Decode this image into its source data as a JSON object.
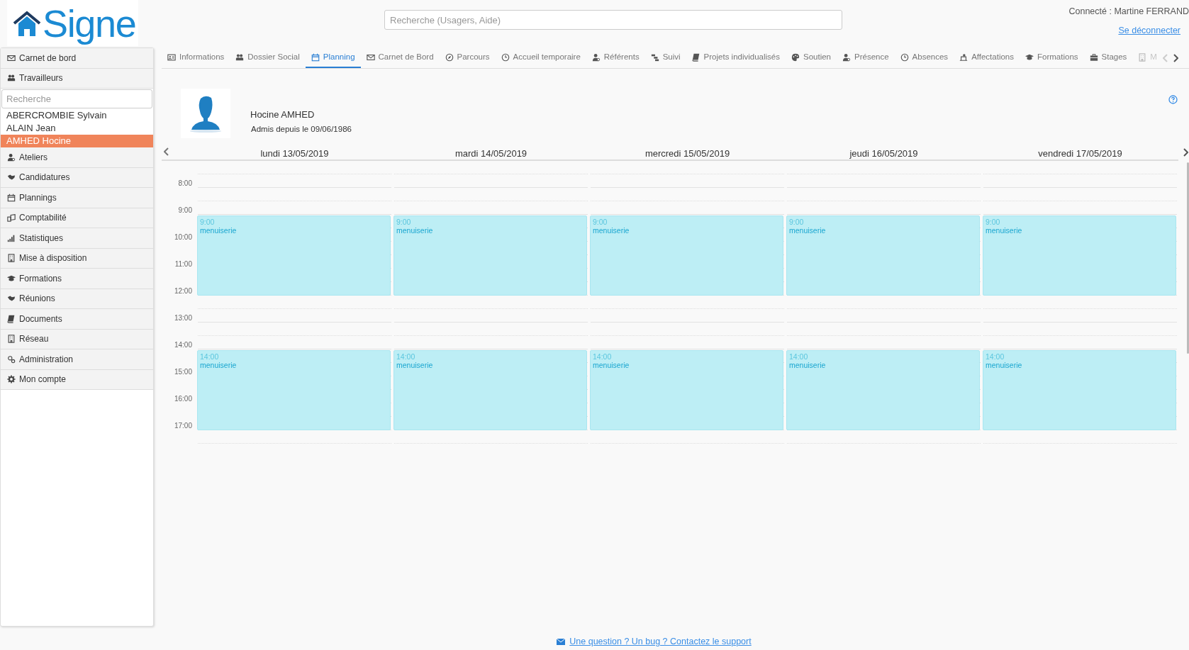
{
  "header": {
    "logo": "Signe",
    "search": {
      "placeholder": "Recherche (Usagers, Aide)"
    },
    "user": "Connecté : Martine FERRAND",
    "logout": "Se déconnecter"
  },
  "sidebar": {
    "items": [
      {
        "kind": "nav",
        "label": "Carnet de bord"
      },
      {
        "kind": "nav",
        "label": "Travailleurs"
      },
      {
        "kind": "search",
        "placeholder": "Recherche"
      },
      {
        "kind": "person",
        "label": "ABERCROMBIE Sylvain",
        "selected": false
      },
      {
        "kind": "person",
        "label": "ALAIN Jean",
        "selected": false
      },
      {
        "kind": "person",
        "label": "AMHED Hocine",
        "selected": true
      },
      {
        "kind": "nav",
        "label": "Ateliers"
      },
      {
        "kind": "nav",
        "label": "Candidatures"
      },
      {
        "kind": "nav",
        "label": "Plannings"
      },
      {
        "kind": "nav",
        "label": "Comptabilité"
      },
      {
        "kind": "nav",
        "label": "Statistiques"
      },
      {
        "kind": "nav",
        "label": "Mise à disposition"
      },
      {
        "kind": "nav",
        "label": "Formations"
      },
      {
        "kind": "nav",
        "label": "Réunions"
      },
      {
        "kind": "nav",
        "label": "Documents"
      },
      {
        "kind": "nav",
        "label": "Réseau"
      },
      {
        "kind": "nav",
        "label": "Administration"
      },
      {
        "kind": "nav",
        "label": "Mon compte"
      }
    ]
  },
  "tabs": [
    {
      "label": "Informations",
      "selected": false
    },
    {
      "label": "Dossier Social",
      "selected": false
    },
    {
      "label": "Planning",
      "selected": true
    },
    {
      "label": "Carnet de Bord",
      "selected": false
    },
    {
      "label": "Parcours",
      "selected": false
    },
    {
      "label": "Accueil temporaire",
      "selected": false
    },
    {
      "label": "Référents",
      "selected": false
    },
    {
      "label": "Suivi",
      "selected": false
    },
    {
      "label": "Projets individualisés",
      "selected": false
    },
    {
      "label": "Soutien",
      "selected": false
    },
    {
      "label": "Présence",
      "selected": false
    },
    {
      "label": "Absences",
      "selected": false
    },
    {
      "label": "Affectations",
      "selected": false
    },
    {
      "label": "Formations",
      "selected": false
    },
    {
      "label": "Stages",
      "selected": false
    },
    {
      "label": "M",
      "selected": false
    }
  ],
  "person": {
    "name": "Hocine AMHED",
    "admitted": "Admis depuis le 09/06/1986"
  },
  "calendar": {
    "hours": [
      "8:00",
      "9:00",
      "10:00",
      "11:00",
      "12:00",
      "13:00",
      "14:00",
      "15:00",
      "16:00",
      "17:00"
    ],
    "days": [
      {
        "label": "lundi 13/05/2019",
        "events": [
          {
            "time": "9:00",
            "title": "menuiserie"
          },
          {
            "time": "14:00",
            "title": "menuiserie"
          }
        ]
      },
      {
        "label": "mardi 14/05/2019",
        "events": [
          {
            "time": "9:00",
            "title": "menuiserie"
          },
          {
            "time": "14:00",
            "title": "menuiserie"
          }
        ]
      },
      {
        "label": "mercredi 15/05/2019",
        "events": [
          {
            "time": "9:00",
            "title": "menuiserie"
          },
          {
            "time": "14:00",
            "title": "menuiserie"
          }
        ]
      },
      {
        "label": "jeudi 16/05/2019",
        "events": [
          {
            "time": "9:00",
            "title": "menuiserie"
          },
          {
            "time": "14:00",
            "title": "menuiserie"
          }
        ]
      },
      {
        "label": "vendredi 17/05/2019",
        "events": [
          {
            "time": "9:00",
            "title": "menuiserie"
          },
          {
            "time": "14:00",
            "title": "menuiserie"
          }
        ]
      }
    ]
  },
  "footer": {
    "link": "Une question ? Un bug ? Contactez le support"
  }
}
